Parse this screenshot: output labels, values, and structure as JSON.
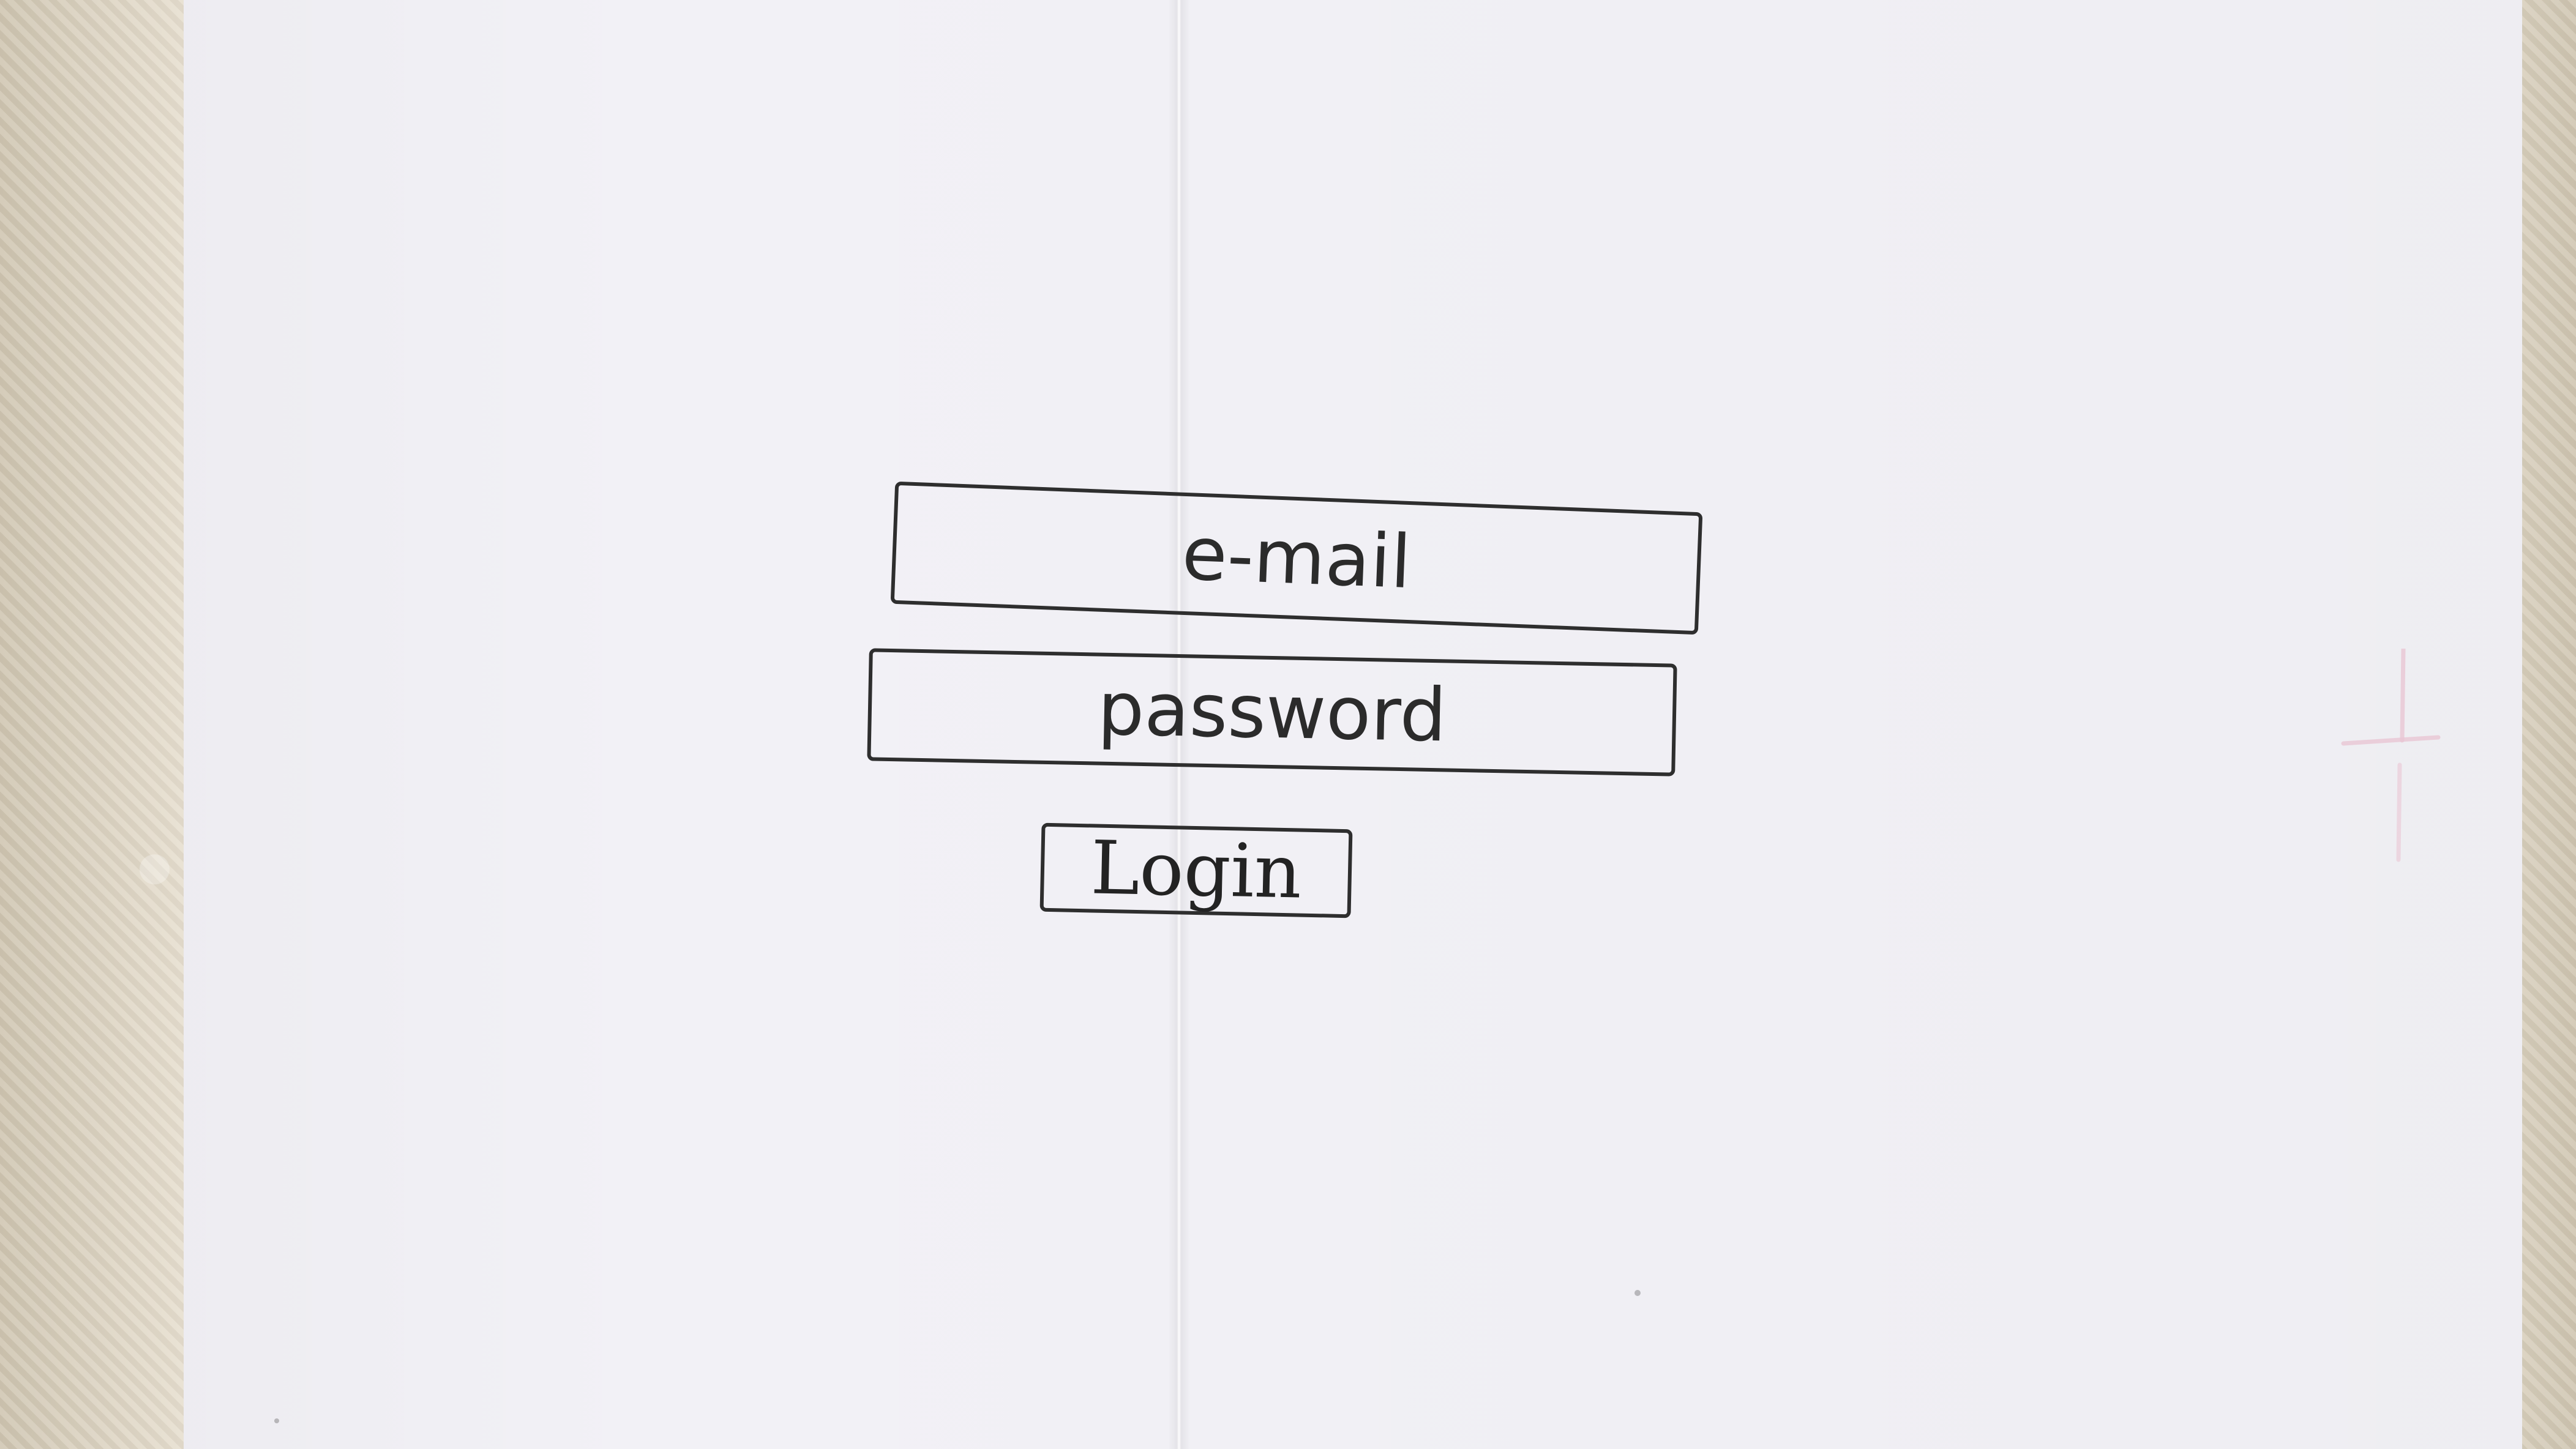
{
  "login_form": {
    "email_placeholder": "e-mail",
    "password_placeholder": "password",
    "login_label": "Login"
  },
  "colors": {
    "ink": "#2e2e2e",
    "paper": "#f2f1f6",
    "background": "#d8d0bf"
  }
}
